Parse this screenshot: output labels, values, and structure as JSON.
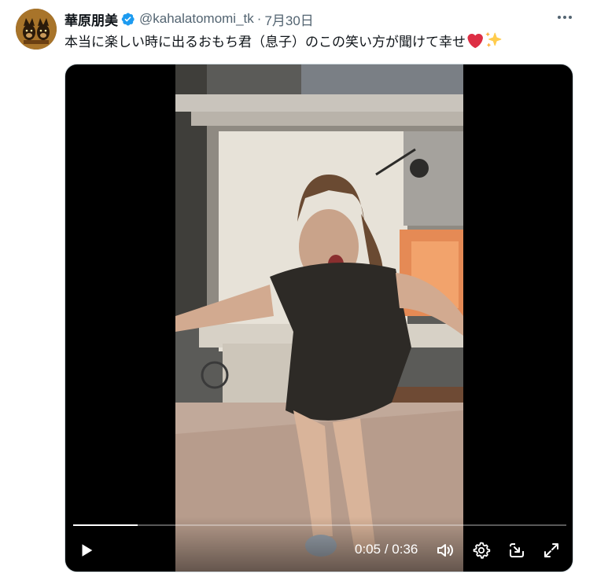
{
  "author": {
    "display_name": "華原朋美",
    "handle": "@kahalatomomi_tk",
    "separator": "·",
    "date": "7月30日",
    "verified": true,
    "avatar_icon": "dog-avatar-icon"
  },
  "tweet": {
    "text": "本当に楽しい時に出るおもち君（息子）のこの笑い方が聞けて幸せ",
    "emojis": [
      "heart-emoji",
      "sparkles-emoji"
    ]
  },
  "video": {
    "current_time": "0:05",
    "duration": "0:36",
    "time_separator": "/",
    "progress": 0.13,
    "controls": [
      "play-icon",
      "volume-icon",
      "settings-icon",
      "popout-icon",
      "fullscreen-icon"
    ]
  },
  "colors": {
    "verified_badge": "#1d9bf0",
    "secondary_text": "#536471",
    "heart": "#e0245e",
    "sparkles": "#ffcc4d"
  }
}
